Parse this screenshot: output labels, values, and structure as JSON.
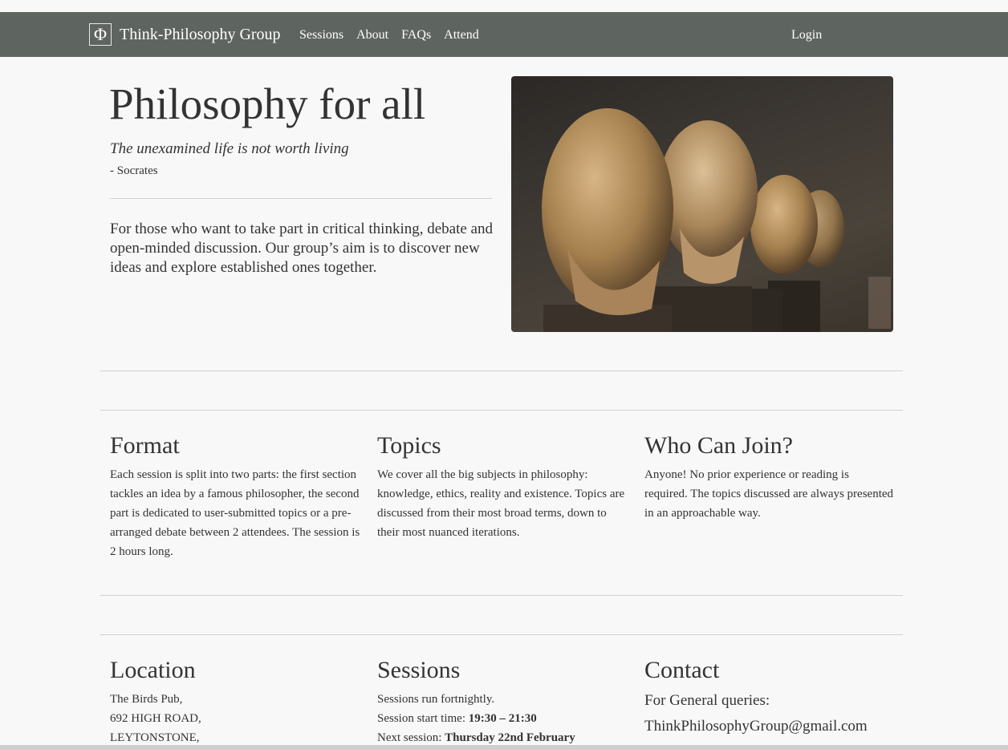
{
  "nav": {
    "logo_glyph": "Φ",
    "brand": "Think-Philosophy Group",
    "links": [
      "Sessions",
      "About",
      "FAQs",
      "Attend"
    ],
    "login": "Login",
    "color": "#5e6560"
  },
  "hero": {
    "title": "Philosophy for all",
    "quote": "The unexamined life is not worth living",
    "author": "- Socrates",
    "text": "For those who want to take part in critical thinking, debate and open-minded discussion. Our group’s aim is to discover new ideas and explore established ones together."
  },
  "features": [
    {
      "title": "Format",
      "text": "Each session is split into two parts: the first section tackles an idea by a famous philosopher, the second part is dedicated to user-submitted topics or a pre-arranged debate between 2 attendees. The session is 2 hours long."
    },
    {
      "title": "Topics",
      "text": "We cover all the big subjects in philosophy: knowledge, ethics, reality and existence. Topics are discussed from their most broad terms, down to their most nuanced iterations."
    },
    {
      "title": "Who Can Join?",
      "text": "Anyone! No prior experience or reading is required. The topics discussed are always presented in an approachable way."
    }
  ],
  "location": {
    "title": "Location",
    "lines": [
      "The Birds Pub,",
      "692 HIGH ROAD,",
      "LEYTONSTONE,"
    ]
  },
  "sessions": {
    "title": "Sessions",
    "line1": "Sessions run fortnightly.",
    "time_label": "Session start time: ",
    "time_value": "19:30 – 21:30",
    "next_label": "Next session: ",
    "next_value": "Thursday 22nd February"
  },
  "contact": {
    "title": "Contact",
    "label": "For General queries:",
    "email": "ThinkPhilosophyGroup@gmail.com"
  }
}
